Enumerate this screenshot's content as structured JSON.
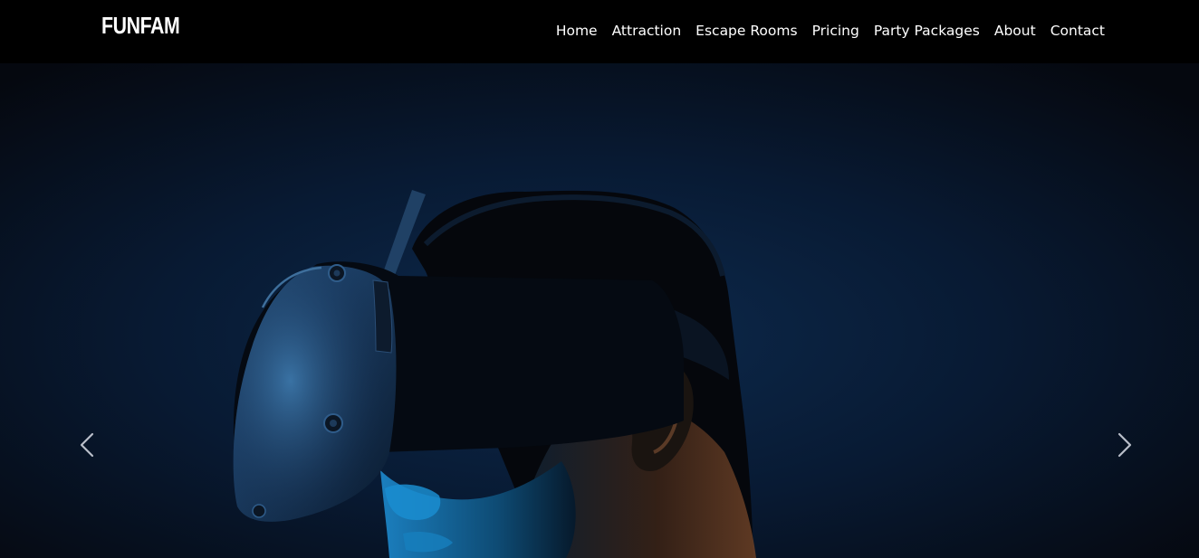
{
  "brand": {
    "name": "FUNFAM"
  },
  "nav": {
    "items": [
      {
        "label": "Home"
      },
      {
        "label": "Attraction"
      },
      {
        "label": "Escape Rooms"
      },
      {
        "label": "Pricing"
      },
      {
        "label": "Party Packages"
      },
      {
        "label": "About"
      },
      {
        "label": "Contact"
      }
    ]
  },
  "hero": {
    "image": "vr-headset-person-photo",
    "controls": {
      "prev_icon": "chevron-left-icon",
      "next_icon": "chevron-right-icon"
    }
  },
  "colors": {
    "navbar_bg": "#000000",
    "text": "#ffffff",
    "hero_bg": "#07152b",
    "accent_blue": "#2a8fd6"
  }
}
